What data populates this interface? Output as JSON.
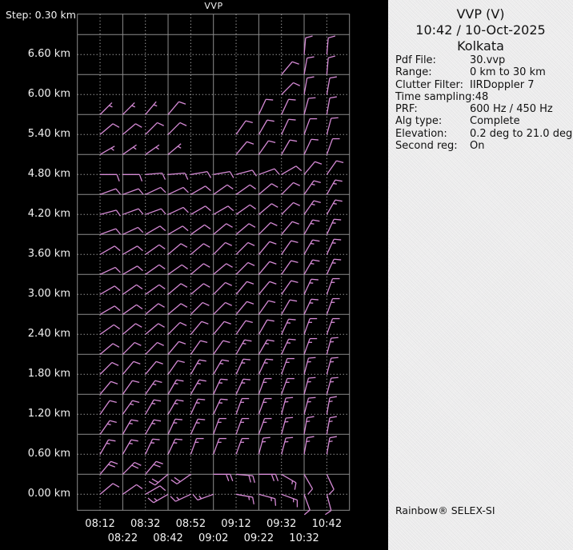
{
  "plot": {
    "title": "VVP",
    "step_label": "Step: 0.30 km",
    "y_axis_labels": [
      "6.60 km",
      "6.00 km",
      "5.40 km",
      "4.80 km",
      "4.20 km",
      "3.60 km",
      "3.00 km",
      "2.40 km",
      "1.80 km",
      "1.20 km",
      "0.60 km",
      "0.00 km"
    ]
  },
  "panel": {
    "title": "VVP (V)",
    "datetime": "10:42 / 10-Oct-2025",
    "site": "Kolkata",
    "fields": [
      {
        "label": "Pdf File:",
        "value": "30.vvp"
      },
      {
        "label": "Range:",
        "value": "0 km to 30 km"
      },
      {
        "label": "Clutter Filter:",
        "value": "IIRDoppler 7"
      },
      {
        "label": "Time sampling:",
        "value": "48"
      },
      {
        "label": "PRF:",
        "value": "600 Hz / 450 Hz"
      },
      {
        "label": "Alg type:",
        "value": "Complete"
      },
      {
        "label": "Elevation:",
        "value": "0.2 deg to 21.0 deg"
      },
      {
        "label": "Second reg:",
        "value": "On"
      }
    ],
    "footer": "Rainbow® SELEX-SI"
  },
  "colors": {
    "plot_bg": "#000000",
    "panel_bg": "#f1f1f1",
    "barb": "#d58ad5",
    "grid_solid": "#8c8c8c",
    "grid_dotted": "#d8d8d8",
    "text_light": "#f2f2f2",
    "text_dark": "#111111"
  },
  "chart_data": {
    "type": "wind-barb-profile",
    "title": "VVP",
    "x_times": [
      "08:12",
      "08:22",
      "08:32",
      "08:42",
      "08:52",
      "09:02",
      "09:12",
      "09:22",
      "09:32",
      "10:32",
      "10:42"
    ],
    "y_heights_km": {
      "min": 0.0,
      "max": 6.6,
      "step": 0.3,
      "labeled_every_km": 0.6
    },
    "units": {
      "speed": "kt",
      "direction": "deg_met_from"
    },
    "legend": "wind barbs per time column and 0.30 km height step; values estimated from barb glyphs",
    "rows": [
      {
        "height_km": 0.0,
        "cols": [
          0,
          1,
          2,
          3,
          4,
          5,
          6,
          7,
          8,
          9,
          10
        ],
        "dir": [
          50,
          55,
          60,
          240,
          245,
          250,
          100,
          105,
          110,
          160,
          165
        ],
        "spd": [
          10,
          10,
          10,
          15,
          15,
          15,
          15,
          15,
          15,
          10,
          10
        ]
      },
      {
        "height_km": 0.3,
        "cols": [
          0,
          1,
          2,
          3,
          4,
          5,
          6,
          7,
          8,
          9,
          10
        ],
        "dir": [
          40,
          45,
          40,
          230,
          235,
          90,
          95,
          90,
          120,
          150,
          155
        ],
        "spd": [
          20,
          20,
          20,
          20,
          20,
          20,
          20,
          20,
          15,
          10,
          10
        ]
      },
      {
        "height_km": 0.6,
        "cols": [
          0,
          1,
          2,
          3,
          4,
          5,
          6,
          7,
          8,
          9,
          10
        ],
        "dir": [
          30,
          30,
          25,
          25,
          20,
          20,
          20,
          15,
          15,
          10,
          10
        ],
        "spd": [
          15,
          15,
          15,
          15,
          15,
          15,
          15,
          15,
          15,
          15,
          15
        ]
      },
      {
        "height_km": 0.9,
        "cols": [
          0,
          1,
          2,
          3,
          4,
          5,
          6,
          7,
          8,
          9,
          10
        ],
        "dir": [
          35,
          30,
          30,
          25,
          25,
          20,
          20,
          20,
          15,
          10,
          10
        ],
        "spd": [
          15,
          15,
          15,
          15,
          15,
          15,
          15,
          15,
          15,
          15,
          15
        ]
      },
      {
        "height_km": 1.2,
        "cols": [
          0,
          1,
          2,
          3,
          4,
          5,
          6,
          7,
          8,
          9,
          10
        ],
        "dir": [
          35,
          35,
          30,
          30,
          25,
          25,
          20,
          20,
          15,
          15,
          10
        ],
        "spd": [
          10,
          15,
          15,
          15,
          15,
          15,
          15,
          15,
          15,
          15,
          15
        ]
      },
      {
        "height_km": 1.5,
        "cols": [
          0,
          1,
          2,
          3,
          4,
          5,
          6,
          7,
          8,
          9,
          10
        ],
        "dir": [
          40,
          35,
          35,
          30,
          30,
          25,
          25,
          20,
          20,
          15,
          15
        ],
        "spd": [
          10,
          10,
          15,
          15,
          15,
          15,
          15,
          15,
          15,
          15,
          15
        ]
      },
      {
        "height_km": 1.8,
        "cols": [
          0,
          1,
          2,
          3,
          4,
          5,
          6,
          7,
          8,
          9,
          10
        ],
        "dir": [
          45,
          40,
          40,
          35,
          30,
          30,
          25,
          25,
          20,
          15,
          15
        ],
        "spd": [
          10,
          10,
          10,
          10,
          15,
          15,
          15,
          15,
          15,
          15,
          15
        ]
      },
      {
        "height_km": 2.1,
        "cols": [
          0,
          1,
          2,
          3,
          4,
          5,
          6,
          7,
          8,
          9,
          10
        ],
        "dir": [
          50,
          45,
          45,
          40,
          35,
          35,
          30,
          30,
          25,
          20,
          15
        ],
        "spd": [
          10,
          10,
          10,
          10,
          10,
          10,
          15,
          15,
          15,
          15,
          15
        ]
      },
      {
        "height_km": 2.4,
        "cols": [
          0,
          1,
          2,
          3,
          4,
          5,
          6,
          7,
          8,
          9,
          10
        ],
        "dir": [
          55,
          50,
          50,
          45,
          40,
          40,
          35,
          30,
          25,
          20,
          20
        ],
        "spd": [
          10,
          10,
          10,
          10,
          10,
          10,
          10,
          10,
          15,
          15,
          15
        ]
      },
      {
        "height_km": 2.7,
        "cols": [
          0,
          1,
          2,
          3,
          4,
          5,
          6,
          7,
          8,
          9,
          10
        ],
        "dir": [
          60,
          55,
          50,
          50,
          45,
          45,
          40,
          35,
          30,
          25,
          20
        ],
        "spd": [
          10,
          10,
          10,
          10,
          10,
          10,
          10,
          10,
          10,
          15,
          15
        ]
      },
      {
        "height_km": 3.0,
        "cols": [
          0,
          1,
          2,
          3,
          4,
          5,
          6,
          7,
          8,
          9,
          10
        ],
        "dir": [
          60,
          55,
          55,
          50,
          50,
          45,
          40,
          40,
          35,
          25,
          20
        ],
        "spd": [
          10,
          10,
          10,
          10,
          10,
          10,
          10,
          10,
          10,
          15,
          15
        ]
      },
      {
        "height_km": 3.3,
        "cols": [
          0,
          1,
          2,
          3,
          4,
          5,
          6,
          7,
          8,
          9,
          10
        ],
        "dir": [
          65,
          60,
          55,
          55,
          50,
          50,
          45,
          40,
          35,
          30,
          25
        ],
        "spd": [
          10,
          10,
          10,
          10,
          10,
          10,
          10,
          10,
          10,
          15,
          15
        ]
      },
      {
        "height_km": 3.6,
        "cols": [
          0,
          1,
          2,
          3,
          4,
          5,
          6,
          7,
          8,
          9,
          10
        ],
        "dir": [
          60,
          60,
          55,
          50,
          50,
          45,
          45,
          40,
          35,
          30,
          25
        ],
        "spd": [
          10,
          10,
          10,
          10,
          10,
          10,
          10,
          10,
          10,
          15,
          15
        ]
      },
      {
        "height_km": 3.9,
        "cols": [
          0,
          1,
          2,
          3,
          4,
          5,
          6,
          7,
          8,
          9,
          10
        ],
        "dir": [
          70,
          65,
          60,
          60,
          55,
          50,
          50,
          45,
          40,
          30,
          25
        ],
        "spd": [
          10,
          10,
          10,
          10,
          10,
          10,
          10,
          10,
          10,
          15,
          15
        ]
      },
      {
        "height_km": 4.2,
        "cols": [
          0,
          1,
          2,
          3,
          4,
          5,
          6,
          7,
          8,
          9,
          10
        ],
        "dir": [
          75,
          70,
          70,
          65,
          60,
          60,
          55,
          50,
          45,
          35,
          30
        ],
        "spd": [
          10,
          10,
          10,
          10,
          10,
          10,
          10,
          10,
          10,
          15,
          15
        ]
      },
      {
        "height_km": 4.5,
        "cols": [
          0,
          1,
          2,
          3,
          4,
          5,
          6,
          7,
          8,
          9,
          10
        ],
        "dir": [
          70,
          70,
          65,
          65,
          60,
          55,
          55,
          50,
          45,
          35,
          30
        ],
        "spd": [
          10,
          10,
          10,
          10,
          10,
          10,
          10,
          10,
          10,
          15,
          15
        ]
      },
      {
        "height_km": 4.8,
        "cols": [
          0,
          1,
          2,
          3,
          4,
          5,
          6,
          7,
          8,
          9,
          10
        ],
        "dir": [
          90,
          90,
          85,
          85,
          80,
          80,
          75,
          70,
          60,
          40,
          35
        ],
        "spd": [
          10,
          10,
          10,
          10,
          10,
          10,
          10,
          10,
          10,
          10,
          10
        ]
      },
      {
        "height_km": 5.1,
        "cols": [
          0,
          1,
          2,
          3,
          6,
          7,
          8,
          9,
          10
        ],
        "dir": [
          60,
          55,
          55,
          50,
          40,
          35,
          30,
          25,
          20
        ],
        "spd": [
          5,
          5,
          5,
          5,
          10,
          10,
          10,
          10,
          10
        ]
      },
      {
        "height_km": 5.4,
        "cols": [
          0,
          1,
          2,
          3,
          6,
          7,
          8,
          9,
          10
        ],
        "dir": [
          50,
          50,
          45,
          45,
          35,
          30,
          25,
          20,
          15
        ],
        "spd": [
          10,
          10,
          10,
          10,
          10,
          10,
          10,
          10,
          10
        ]
      },
      {
        "height_km": 5.7,
        "cols": [
          0,
          1,
          2,
          3,
          7,
          8,
          9,
          10
        ],
        "dir": [
          45,
          45,
          40,
          40,
          25,
          25,
          15,
          10
        ],
        "spd": [
          5,
          5,
          5,
          10,
          10,
          10,
          10,
          10
        ]
      },
      {
        "height_km": 6.0,
        "cols": [
          8,
          9,
          10
        ],
        "dir": [
          45,
          10,
          10
        ],
        "spd": [
          10,
          10,
          10
        ]
      },
      {
        "height_km": 6.3,
        "cols": [
          8,
          9,
          10
        ],
        "dir": [
          40,
          10,
          5
        ],
        "spd": [
          10,
          10,
          10
        ]
      },
      {
        "height_km": 6.6,
        "cols": [
          9,
          10
        ],
        "dir": [
          5,
          5
        ],
        "spd": [
          10,
          10
        ]
      }
    ]
  }
}
